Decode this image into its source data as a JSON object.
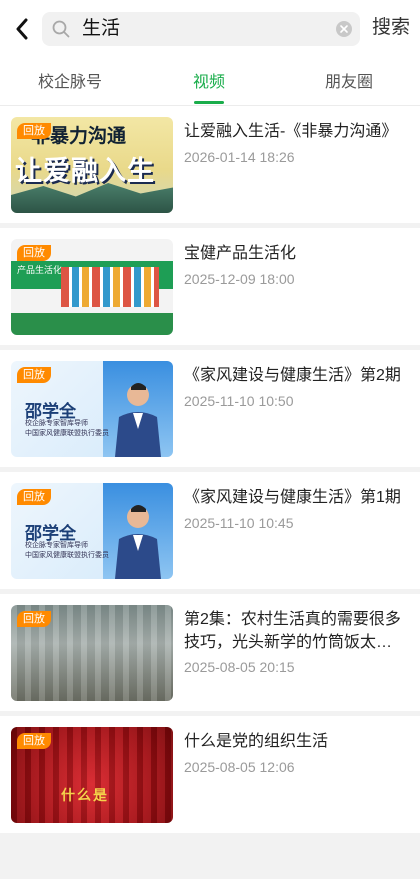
{
  "search": {
    "query": "生活",
    "button_label": "搜索"
  },
  "tabs": [
    {
      "label": "校企脉号",
      "active": false
    },
    {
      "label": "视频",
      "active": true
    },
    {
      "label": "朋友圈",
      "active": false
    }
  ],
  "colors": {
    "accent": "#1aad4b",
    "badge": "#ff8a00"
  },
  "results": [
    {
      "badge": "回放",
      "title": "让爱融入生活-《非暴力沟通》",
      "date": "2026-01-14 18:26",
      "thumb_text": {
        "top": "非暴力沟通",
        "main": "让爱融入生活"
      }
    },
    {
      "badge": "回放",
      "title": "宝健产品生活化",
      "date": "2025-12-09 18:00",
      "thumb_text": {
        "bar": "产品生活化"
      }
    },
    {
      "badge": "回放",
      "title": "《家风建设与健康生活》第2期",
      "date": "2025-11-10 10:50",
      "thumb_text": {
        "name": "邵学全",
        "sub1": "校企脉专家智库导师",
        "sub2": "中国家风健康联盟执行委员"
      }
    },
    {
      "badge": "回放",
      "title": "《家风建设与健康生活》第1期",
      "date": "2025-11-10 10:45",
      "thumb_text": {
        "name": "邵学全",
        "sub1": "校企脉专家智库导师",
        "sub2": "中国家风健康联盟执行委员"
      }
    },
    {
      "badge": "回放",
      "title": "第2集：农村生活真的需要很多技巧，光头新学的竹筒饭太…",
      "date": "2025-08-05 20:15"
    },
    {
      "badge": "回放",
      "title": "什么是党的组织生活",
      "date": "2025-08-05 12:06",
      "thumb_text": {
        "gold": "什么是"
      }
    }
  ]
}
